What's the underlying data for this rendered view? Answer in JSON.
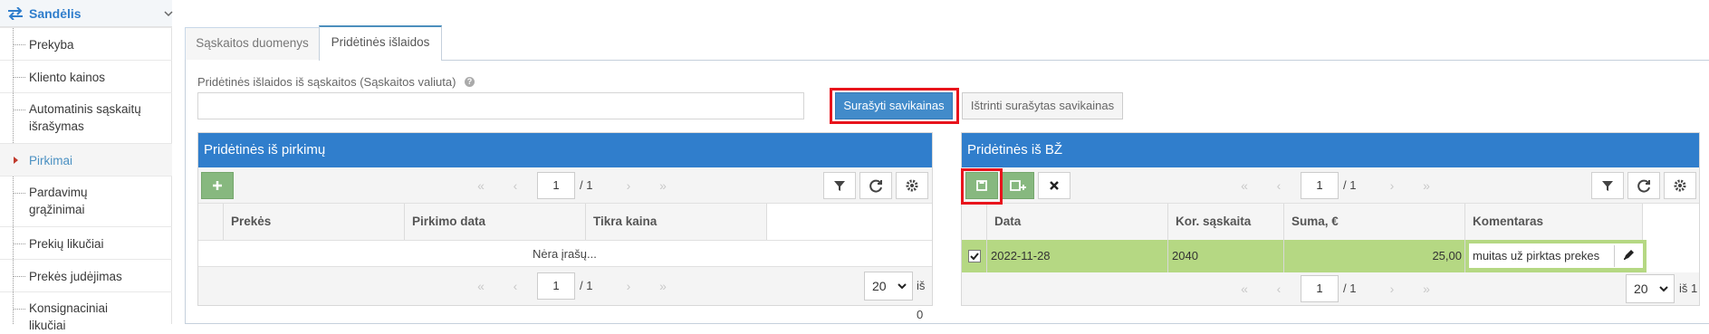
{
  "sidebar": {
    "section_title": "Sandėlis",
    "items": [
      {
        "label": "Prekyba"
      },
      {
        "label": "Kliento kainos"
      },
      {
        "label": "Automatinis sąskaitų išrašymas"
      },
      {
        "label": "Pirkimai",
        "active": true
      },
      {
        "label": "Pardavimų grąžinimai"
      },
      {
        "label": "Prekių likučiai"
      },
      {
        "label": "Prekės judėjimas"
      },
      {
        "label": "Konsignaciniai likučiai"
      }
    ]
  },
  "tabs": [
    {
      "label": "Sąskaitos duomenys"
    },
    {
      "label": "Pridėtinės išlaidos",
      "active": true
    }
  ],
  "form": {
    "field_label": "Pridėtinės išlaidos iš sąskaitos (Sąskaitos valiuta)",
    "help_icon": "question-circle-icon",
    "field_value": "",
    "btn_fill": "Surašyti savikainas",
    "btn_delete": "Ištrinti surašytas savikainas"
  },
  "left_panel": {
    "title": "Pridėtinės iš pirkimų",
    "columns": [
      "Prekės",
      "Pirkimo data",
      "Tikra kaina"
    ],
    "empty_text": "Nėra įrašų...",
    "page": "1",
    "page_of": "/ 1",
    "page_size": "20",
    "total": "iš 0"
  },
  "right_panel": {
    "title": "Pridėtinės iš BŽ",
    "columns": [
      "Data",
      "Kor. sąskaita",
      "Suma, €",
      "Komentaras"
    ],
    "rows": [
      {
        "checked": true,
        "date": "2022-11-28",
        "account": "2040",
        "amount": "25,00",
        "comment": "muitas už pirktas prekes"
      }
    ],
    "page": "1",
    "page_of": "/ 1",
    "page_size": "20",
    "total": "iš 1"
  },
  "colors": {
    "brand_blue": "#307ecc",
    "primary_button": "#428bca",
    "green_button": "#87b87f",
    "selected_row": "#b5d883",
    "highlight": "#e8141c"
  }
}
